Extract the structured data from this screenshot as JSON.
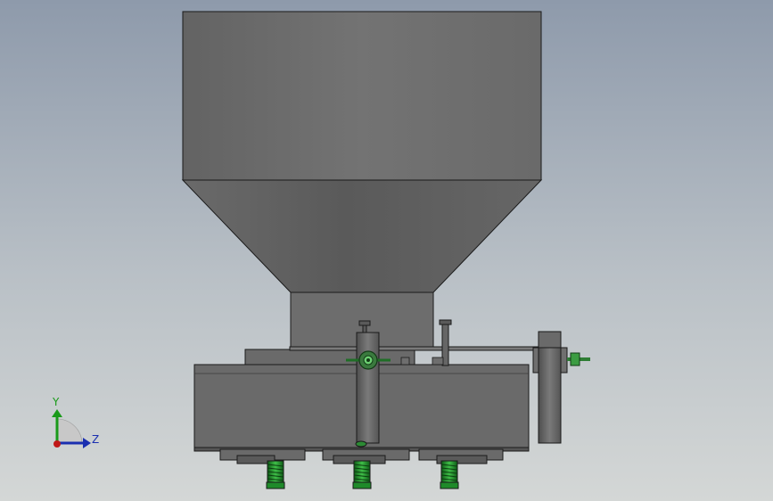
{
  "colors": {
    "background_top": "#8e9aab",
    "background_bottom": "#d4d7d6",
    "body_dark": "#5f5f5f",
    "body_mid": "#6c6c6c",
    "body_light": "#787878",
    "edge": "#1a1a1a",
    "spring_green": "#1f8a2a",
    "axis_y": "#1a9a1a",
    "axis_z": "#1a2fb0",
    "axis_x": "#c01818"
  },
  "triad": {
    "y_label": "Y",
    "z_label": "Z"
  }
}
